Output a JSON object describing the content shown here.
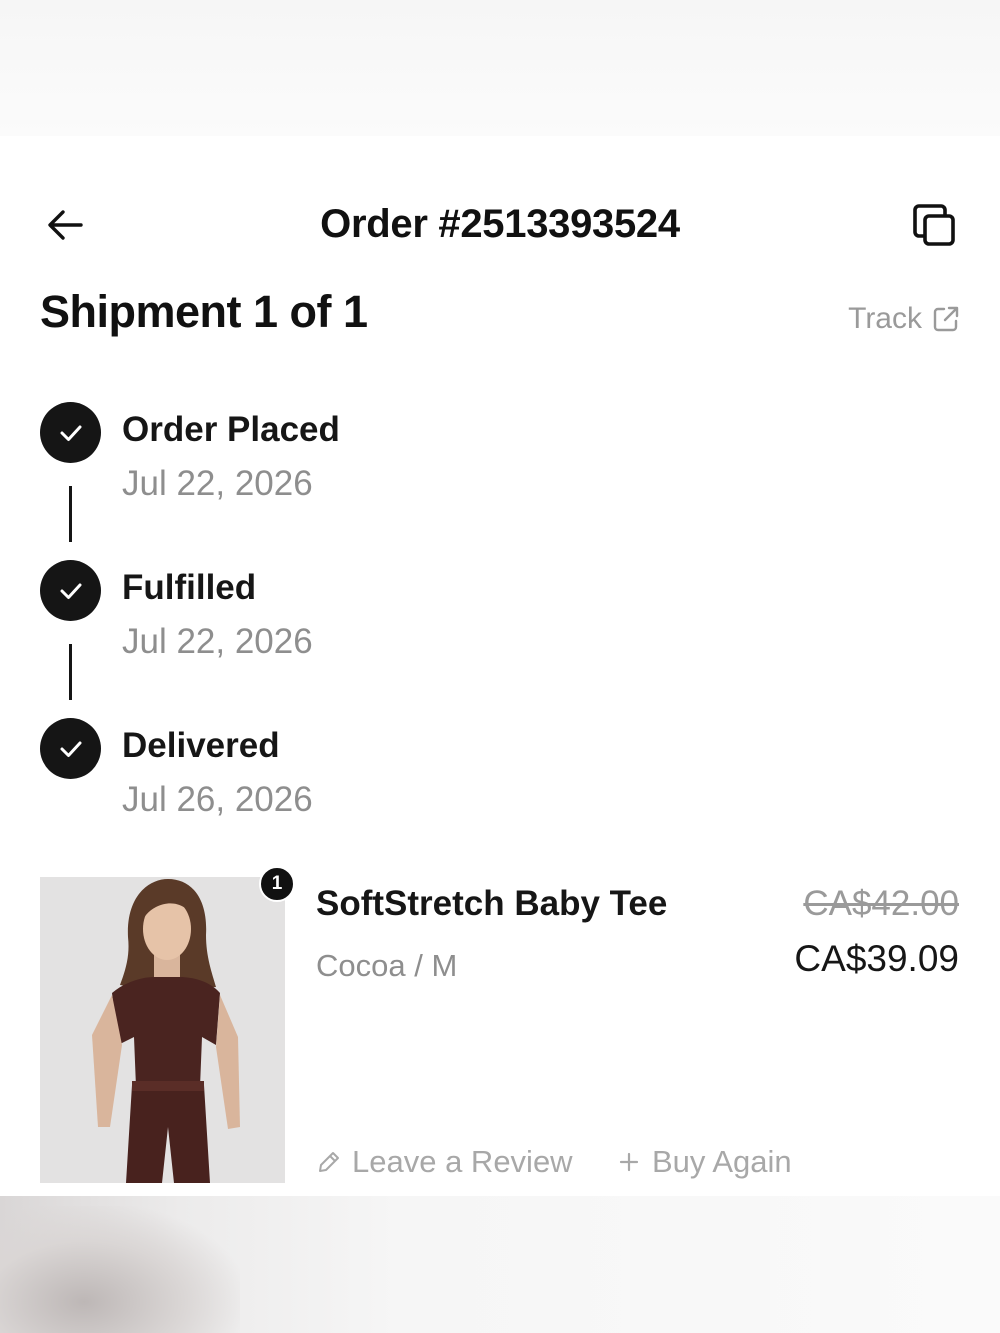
{
  "header": {
    "title": "Order #2513393524",
    "back_icon": "arrow-left-icon",
    "copy_icon": "copy-icon"
  },
  "shipment": {
    "title": "Shipment 1 of 1",
    "track_label": "Track",
    "track_icon": "external-link-icon"
  },
  "timeline": {
    "steps": [
      {
        "label": "Order Placed",
        "date": "Jul 22, 2026",
        "icon": "check-icon"
      },
      {
        "label": "Fulfilled",
        "date": "Jul 22, 2026",
        "icon": "check-icon"
      },
      {
        "label": "Delivered",
        "date": "Jul 26, 2026",
        "icon": "check-icon"
      }
    ]
  },
  "product": {
    "quantity": "1",
    "name": "SoftStretch Baby Tee",
    "variant": "Cocoa / M",
    "original_price": "CA$42.00",
    "price": "CA$39.09",
    "review_label": "Leave a Review",
    "review_icon": "pencil-icon",
    "buy_again_label": "Buy Again",
    "buy_again_icon": "plus-icon"
  },
  "colors": {
    "text_primary": "#111111",
    "text_secondary": "#8e8e8e",
    "step_fill": "#151515",
    "product_color": "#4a2420"
  }
}
